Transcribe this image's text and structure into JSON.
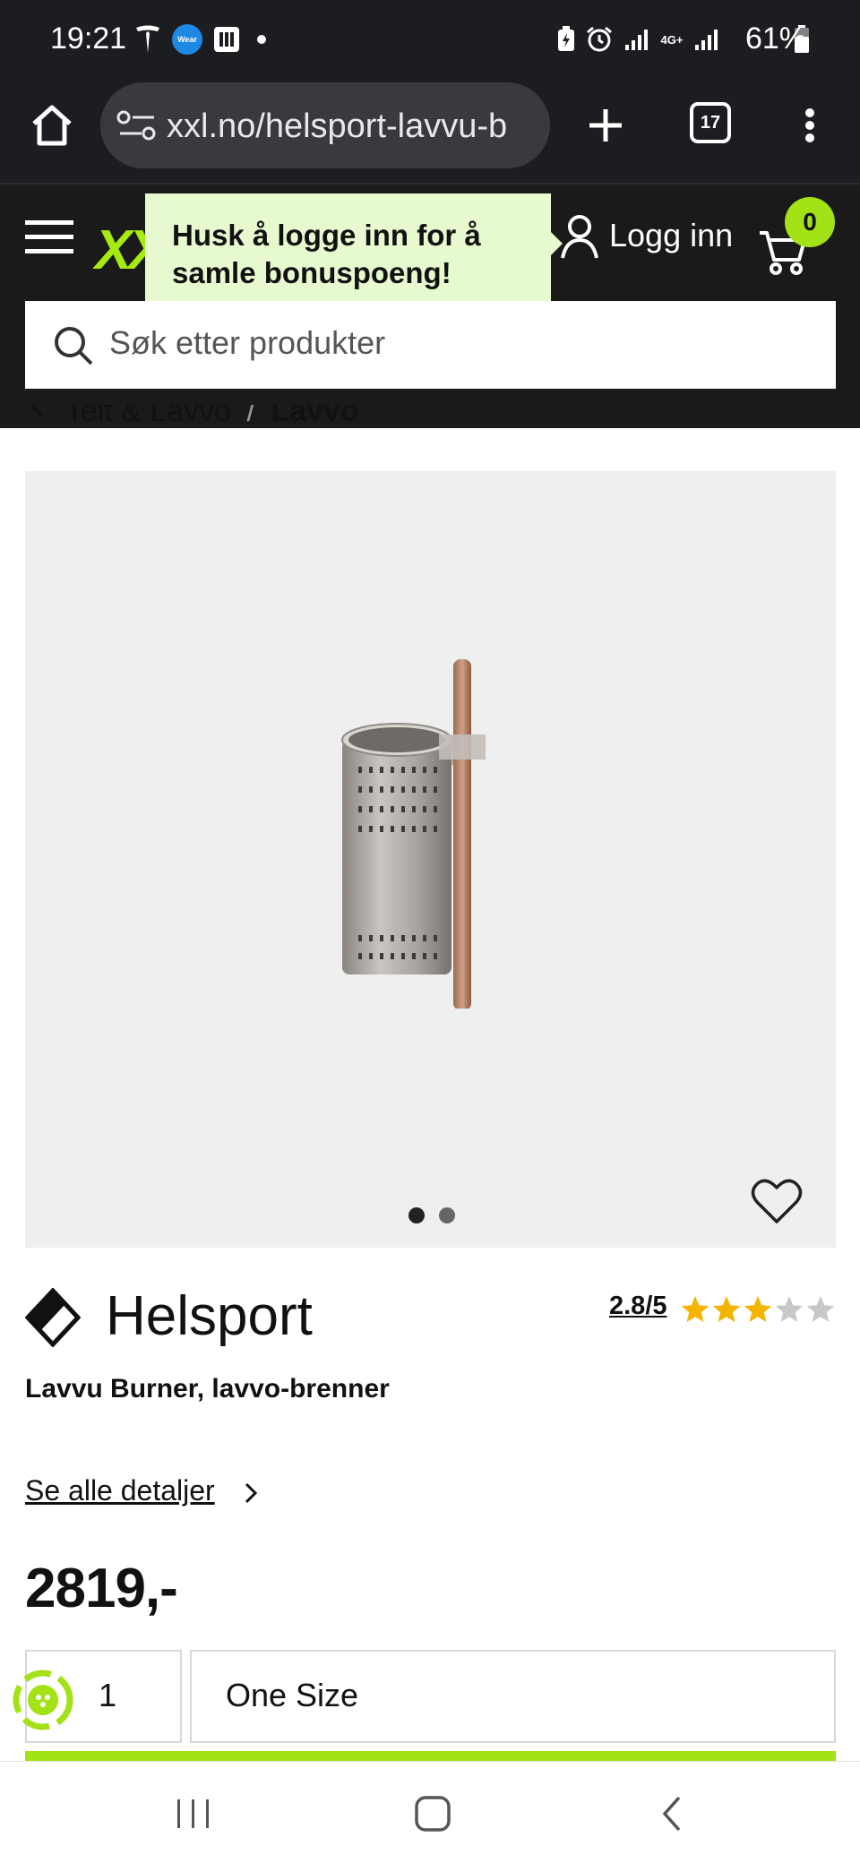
{
  "status_bar": {
    "time": "19:21",
    "wear_badge": "Wear",
    "network": "4G+",
    "battery": "61%"
  },
  "browser": {
    "url": "xxl.no/helsport-lavvu-b",
    "tab_count": "17"
  },
  "header": {
    "logo": "XX",
    "tooltip": "Husk å logge inn for å samle bonuspoeng!",
    "login_label": "Logg inn",
    "cart_count": "0",
    "search_placeholder": "Søk etter produkter"
  },
  "breadcrumb": {
    "parent": "Telt & Lavvo",
    "separator": "/",
    "current": "Lavvo"
  },
  "product": {
    "brand": "Helsport",
    "rating_text": "2.8/5",
    "rating_value": 2.8,
    "rating_max": 5,
    "title": "Lavvu Burner, lavvo-brenner",
    "details_link": "Se alle detaljer",
    "price": "2819,-",
    "quantity": "1",
    "size": "One Size",
    "image_count": 2,
    "active_image": 1
  },
  "colors": {
    "brand_green": "#a3e217",
    "header_bg": "#1a1a1a",
    "tooltip_bg": "#e7f9cf",
    "star_filled": "#f5b400",
    "star_empty": "#c8c8c8"
  }
}
